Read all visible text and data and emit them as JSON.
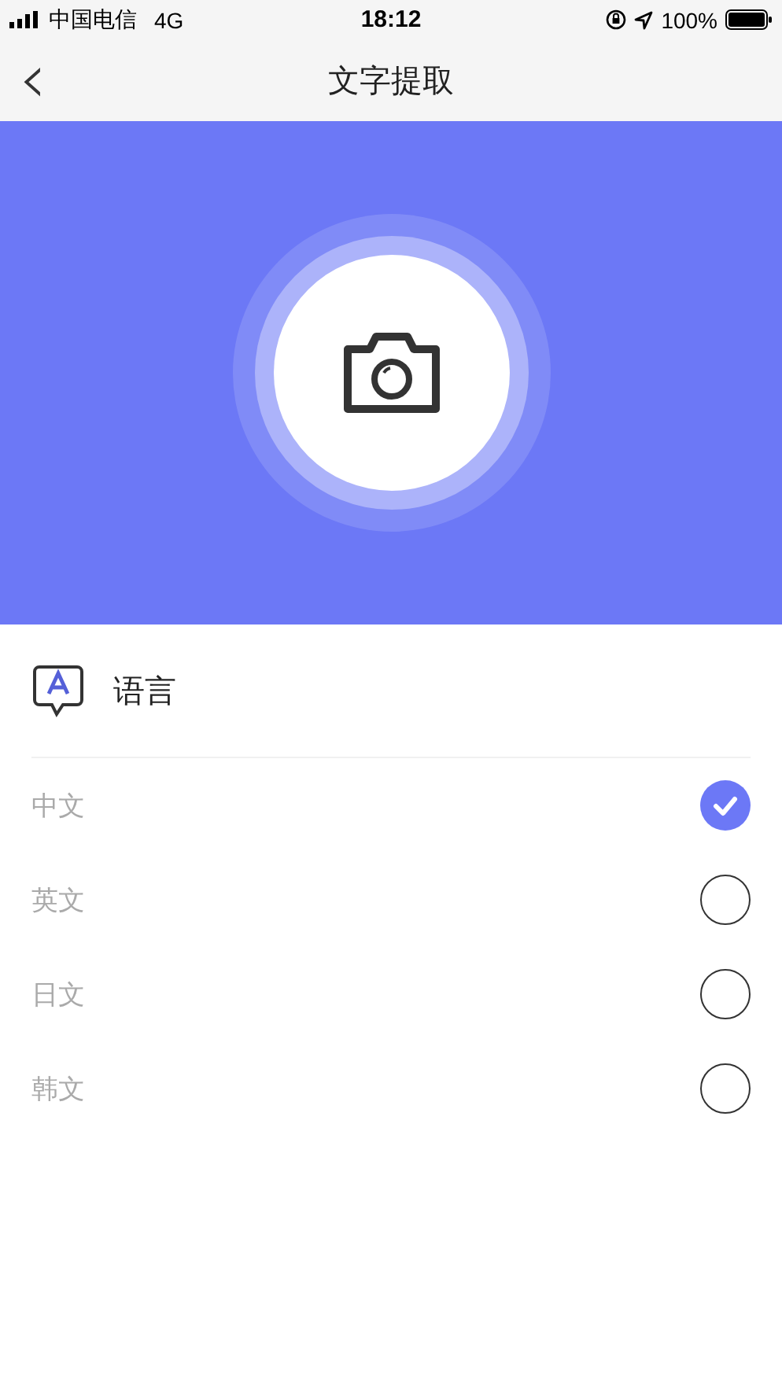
{
  "status_bar": {
    "carrier": "中国电信",
    "network": "4G",
    "time": "18:12",
    "battery": "100%"
  },
  "nav": {
    "back": "‹",
    "title": "文字提取"
  },
  "section": {
    "title": "语言"
  },
  "languages": [
    {
      "label": "中文",
      "selected": true
    },
    {
      "label": "英文",
      "selected": false
    },
    {
      "label": "日文",
      "selected": false
    },
    {
      "label": "韩文",
      "selected": false
    }
  ]
}
